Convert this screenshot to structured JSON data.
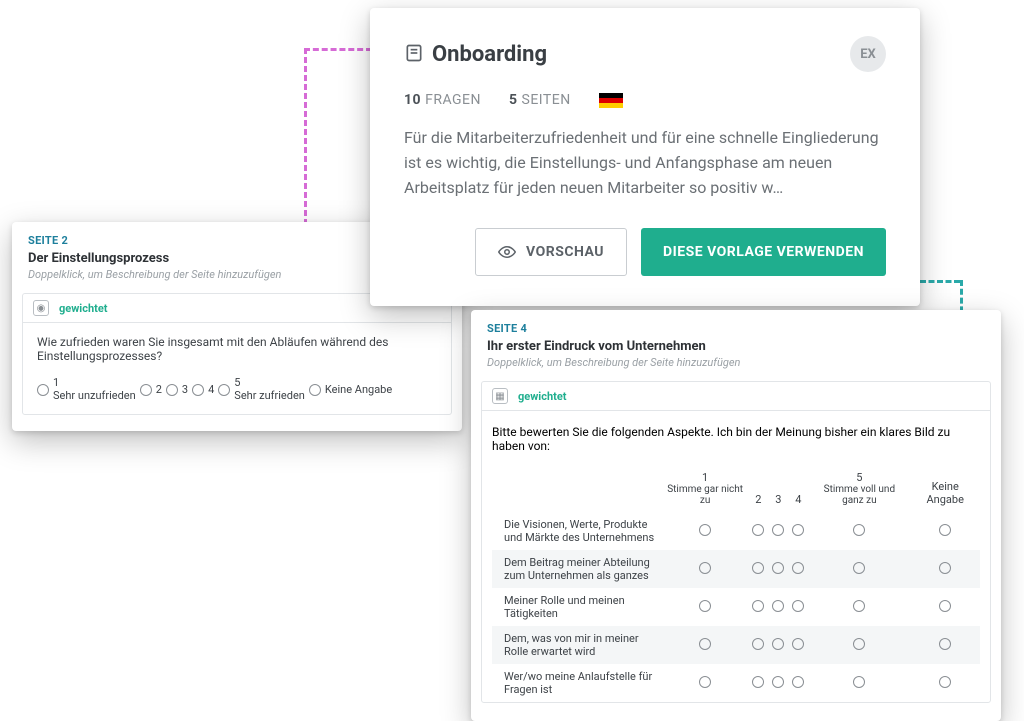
{
  "header": {
    "title": "Onboarding",
    "badge": "EX",
    "meta": {
      "q_count": "10",
      "q_word": "FRAGEN",
      "p_count": "5",
      "p_word": "SEITEN"
    },
    "description": "Für die Mitarbeiterzufriedenheit und für eine schnelle Eingliederung ist es wichtig, die Einstellungs- und Anfangsphase am neuen Arbeitsplatz für jeden neuen Mitarbeiter so positiv w…",
    "preview_btn": "VORSCHAU",
    "use_btn": "DIESE VORLAGE VERWENDEN"
  },
  "page2": {
    "label": "SEITE 2",
    "title": "Der Einstellungsprozess",
    "sub": "Doppelklick, um Beschreibung der Seite hinzuzufügen",
    "weighted": "gewichtet",
    "question": "Wie zufrieden waren Sie insgesamt mit den Abläufen während des Einstellungsprozesses?",
    "scale": {
      "o1_top": "1",
      "o1_bot": "Sehr unzufrieden",
      "o2": "2",
      "o3": "3",
      "o4": "4",
      "o5_top": "5",
      "o5_bot": "Sehr zufrieden",
      "na": "Keine Angabe"
    }
  },
  "page4": {
    "label": "SEITE 4",
    "title": "Ihr erster Eindruck vom Unternehmen",
    "sub": "Doppelklick, um Beschreibung der Seite hinzuzufügen",
    "weighted": "gewichtet",
    "question": "Bitte bewerten Sie die folgenden Aspekte. Ich bin der Meinung bisher ein klares Bild  zu haben von:",
    "cols": {
      "c1_top": "1",
      "c1_bot": "Stimme gar nicht zu",
      "c2": "2",
      "c3": "3",
      "c4": "4",
      "c5_top": "5",
      "c5_bot": "Stimme voll und ganz zu",
      "na": "Keine Angabe"
    },
    "rows": [
      "Die Visionen, Werte, Produkte und Märkte des Unternehmens",
      "Dem Beitrag meiner Abteilung zum Unternehmen als ganzes",
      "Meiner Rolle und meinen Tätigkeiten",
      "Dem, was von mir in meiner Rolle erwartet wird",
      "Wer/wo meine Anlaufstelle für Fragen ist"
    ]
  }
}
